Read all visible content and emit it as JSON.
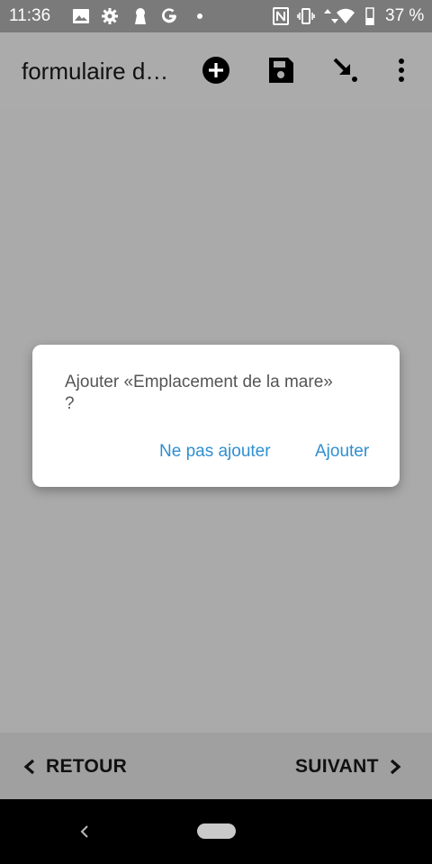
{
  "status_bar": {
    "time": "11:36",
    "battery_percent": "37 %",
    "icons": [
      "image-icon",
      "settings-icon",
      "keyhole-icon",
      "google-icon",
      "dot-icon",
      "nfc-icon",
      "vibrate-icon",
      "data-arrows-icon",
      "wifi-icon",
      "battery-icon"
    ]
  },
  "app_bar": {
    "title": "formulaire de terrain",
    "actions": [
      "add-circle-icon",
      "save-icon",
      "download-arrow-icon",
      "more-vert-icon"
    ]
  },
  "dialog": {
    "message": "Ajouter «Emplacement de la mare» ?",
    "negative": "Ne pas ajouter",
    "positive": "Ajouter"
  },
  "bottom_nav": {
    "back": "RETOUR",
    "next": "SUIVANT"
  },
  "colors": {
    "accent": "#2f8fd0",
    "background": "#aaaaaa",
    "status_bar": "#7a7a7a"
  }
}
